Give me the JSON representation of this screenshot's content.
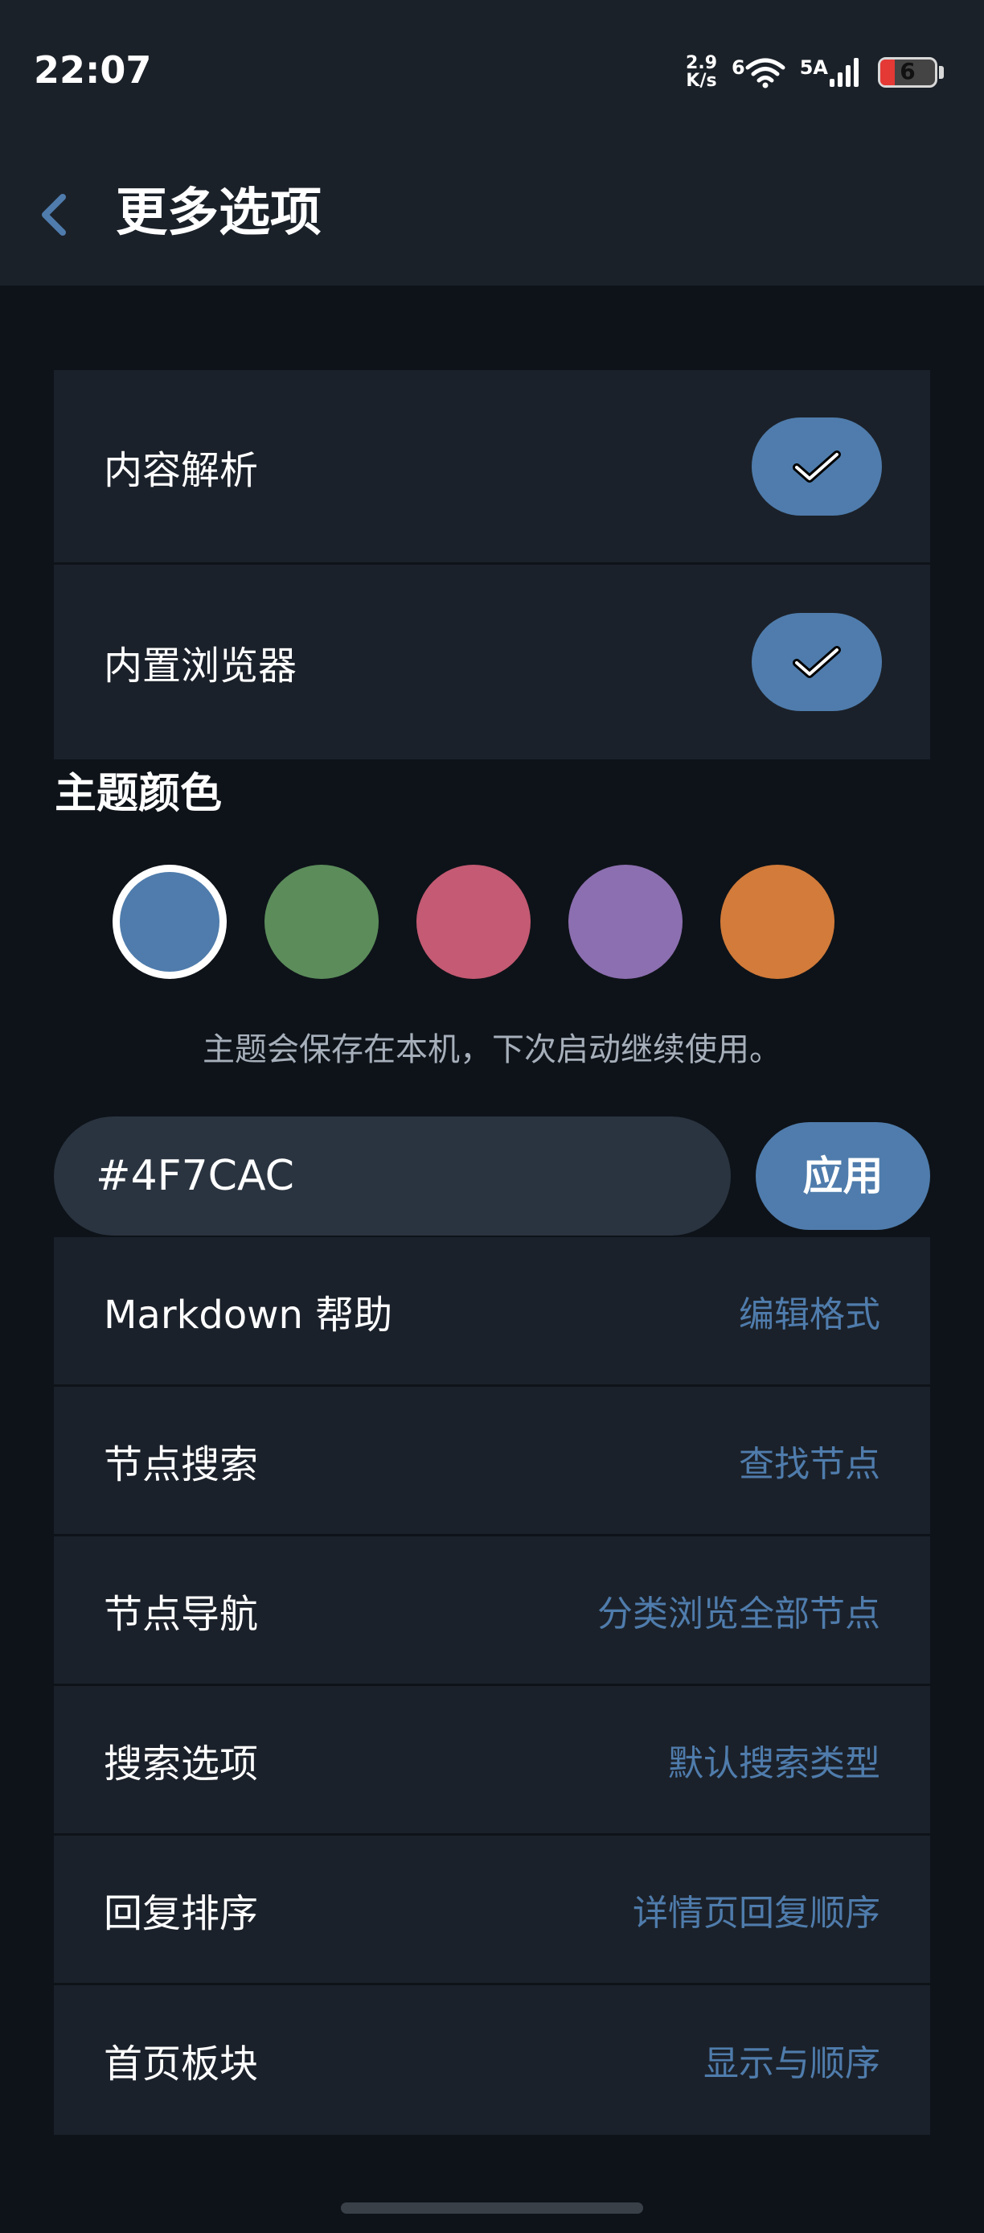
{
  "status_bar": {
    "time": "22:07",
    "net_speed_value": "2.9",
    "net_speed_unit": "K/s",
    "wifi_label": "6",
    "signal_label": "5A",
    "battery_level": "6",
    "icons": [
      "wifi-icon",
      "signal-icon",
      "battery-icon"
    ]
  },
  "header": {
    "title": "更多选项",
    "back_icon": "chevron-left-icon"
  },
  "toggles": [
    {
      "label": "内容解析",
      "checked": true
    },
    {
      "label": "内置浏览器",
      "checked": true
    }
  ],
  "theme": {
    "section_title": "主题颜色",
    "swatches": [
      "#4f7cac",
      "#5b8c5a",
      "#c45a73",
      "#8c6fb0",
      "#d27b3a"
    ],
    "selected_index": 0,
    "note": "主题会保存在本机，下次启动继续使用。",
    "hex_value": "#4F7CAC",
    "apply_label": "应用"
  },
  "links": [
    {
      "label": "Markdown 帮助",
      "sub": "编辑格式"
    },
    {
      "label": "节点搜索",
      "sub": "查找节点"
    },
    {
      "label": "节点导航",
      "sub": "分类浏览全部节点"
    },
    {
      "label": "搜索选项",
      "sub": "默认搜索类型"
    },
    {
      "label": "回复排序",
      "sub": "详情页回复顺序"
    },
    {
      "label": "首页板块",
      "sub": "显示与顺序"
    }
  ],
  "colors": {
    "accent": "#4f7cac",
    "background": "#0e1319",
    "surface": "#1b212a"
  }
}
